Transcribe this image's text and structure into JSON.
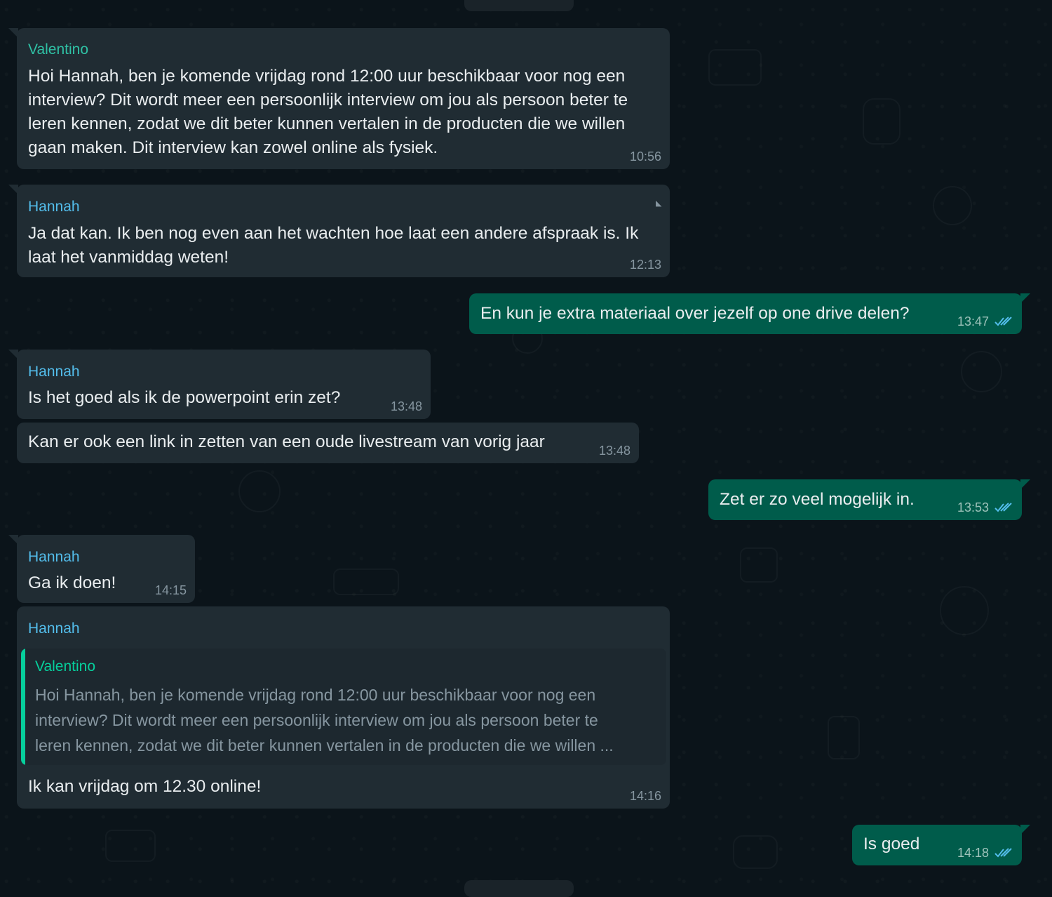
{
  "messages": [
    {
      "sender": "Valentino",
      "lines": [
        "Hoi Hannah, ben je komende vrijdag rond 12:00 uur beschikbaar voor nog een",
        "interview? Dit wordt meer een persoonlijk interview om jou als persoon beter te",
        "leren kennen, zodat we dit beter kunnen vertalen in de producten die we willen",
        "gaan maken. Dit interview kan zowel online als fysiek."
      ],
      "time": "10:56"
    },
    {
      "sender": "Hannah",
      "lines": [
        "Ja dat kan. Ik ben nog even aan het wachten hoe laat een andere afspraak is. Ik",
        "laat het vanmiddag weten!"
      ],
      "time": "12:13"
    },
    {
      "text": "En kun je extra materiaal over jezelf op one drive delen?",
      "time": "13:47"
    },
    {
      "sender": "Hannah",
      "text": "Is het goed als ik de powerpoint erin zet?",
      "time": "13:48"
    },
    {
      "text": "Kan er ook een link in zetten van een oude livestream van vorig jaar",
      "time": "13:48"
    },
    {
      "text": "Zet er zo veel mogelijk in.",
      "time": "13:53"
    },
    {
      "sender": "Hannah",
      "text": "Ga ik doen!",
      "time": "14:15"
    },
    {
      "sender": "Hannah",
      "quote": {
        "sender": "Valentino",
        "lines": [
          "Hoi Hannah, ben je komende vrijdag rond 12:00 uur beschikbaar voor nog een",
          "interview? Dit wordt meer een persoonlijk interview om jou als persoon beter te",
          "leren kennen, zodat we dit beter kunnen vertalen in de producten die we willen ..."
        ]
      },
      "text": "Ik kan vrijdag om 12.30 online!",
      "time": "14:16"
    },
    {
      "text": "Is goed",
      "time": "14:18"
    }
  ],
  "colors": {
    "background": "#0b141a",
    "incoming_bubble": "#202c33",
    "outgoing_bubble": "#005c4b",
    "valentino_name": "#2fc1a5",
    "hannah_name": "#53bdeb",
    "read_ticks": "#53bdeb"
  },
  "icons": {
    "read_receipt": "double-check-icon",
    "message_menu": "chevron-down-icon"
  }
}
